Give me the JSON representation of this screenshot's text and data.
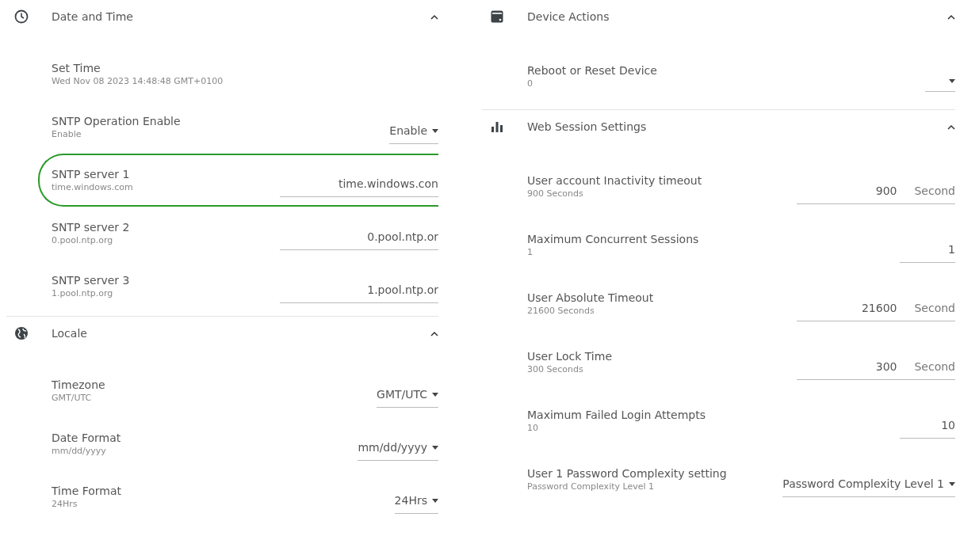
{
  "panels": [
    {
      "sections": [
        {
          "title": "Date and Time",
          "expanded": true,
          "settings": [
            {
              "kind": "text",
              "label": "Set Time",
              "value": "Wed Nov 08 2023 14:48:48 GMT+0100",
              "highlighted": false
            },
            {
              "kind": "select",
              "label": "SNTP Operation Enable",
              "value": "Enable",
              "control": "Enable",
              "highlighted": false
            },
            {
              "kind": "input",
              "label": "SNTP server 1",
              "value": "time.windows.com",
              "control": "time.windows.con",
              "highlighted": true
            },
            {
              "kind": "input",
              "label": "SNTP server 2",
              "value": "0.pool.ntp.org",
              "control": "0.pool.ntp.or",
              "highlighted": false
            },
            {
              "kind": "input",
              "label": "SNTP server 3",
              "value": "1.pool.ntp.org",
              "control": "1.pool.ntp.or",
              "highlighted": false
            }
          ]
        },
        {
          "title": "Locale",
          "expanded": true,
          "settings": [
            {
              "kind": "select",
              "label": "Timezone",
              "value": "GMT/UTC",
              "control": "GMT/UTC",
              "highlighted": false
            },
            {
              "kind": "select",
              "label": "Date Format",
              "value": "mm/dd/yyyy",
              "control": "mm/dd/yyyy",
              "highlighted": false
            },
            {
              "kind": "select",
              "label": "Time Format",
              "value": "24Hrs",
              "control": "24Hrs",
              "highlighted": false
            }
          ]
        }
      ]
    },
    {
      "sections": [
        {
          "title": "Device Actions",
          "expanded": true,
          "settings": [
            {
              "kind": "select",
              "label": "Reboot or Reset Device",
              "value": "0",
              "highlighted": false
            }
          ]
        },
        {
          "title": "Web Session Settings",
          "expanded": true,
          "settings": [
            {
              "kind": "input",
              "label": "User account Inactivity timeout",
              "value": "900 Seconds",
              "control": "900",
              "unit": "Second",
              "highlighted": false
            },
            {
              "kind": "input",
              "label": "Maximum Concurrent Sessions",
              "value": "1",
              "control": "1",
              "highlighted": false
            },
            {
              "kind": "input",
              "label": "User Absolute Timeout",
              "value": "21600 Seconds",
              "control": "21600",
              "unit": "Second",
              "highlighted": false
            },
            {
              "kind": "input",
              "label": "User Lock Time",
              "value": "300 Seconds",
              "control": "300",
              "unit": "Second",
              "highlighted": false
            },
            {
              "kind": "input",
              "label": "Maximum Failed Login Attempts",
              "value": "10",
              "control": "10",
              "highlighted": false
            },
            {
              "kind": "select",
              "label": "User 1 Password Complexity setting",
              "value": "Password Complexity Level 1",
              "control": "Password Complexity Level 1",
              "highlighted": false
            }
          ]
        }
      ]
    }
  ]
}
